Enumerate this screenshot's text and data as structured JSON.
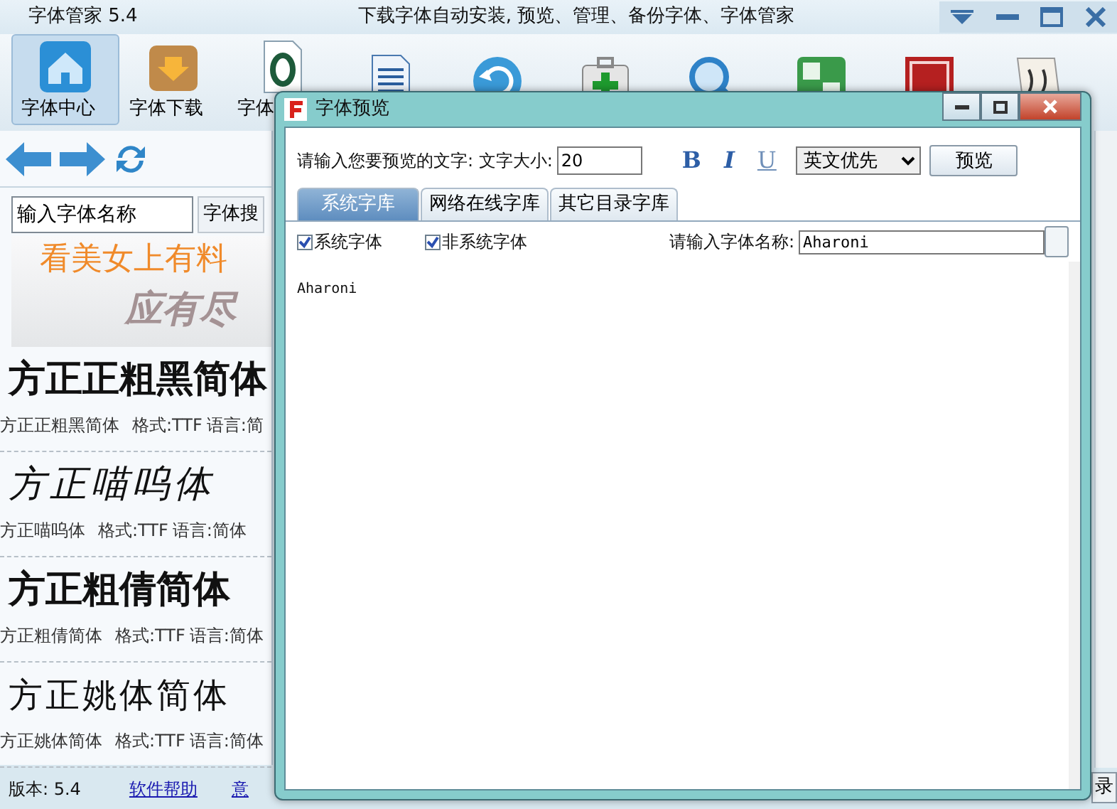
{
  "window": {
    "title": "字体管家 5.4",
    "subtitle": "下载字体自动安装, 预览、管理、备份字体、字体管家"
  },
  "toolbar": [
    {
      "kind": "home",
      "label": "字体中心",
      "selected": true
    },
    {
      "kind": "download",
      "label": "字体下载",
      "selected": false
    },
    {
      "kind": "fontfile",
      "label": "字体",
      "selected": false
    },
    {
      "kind": "document",
      "selected": false
    },
    {
      "kind": "undo",
      "selected": false
    },
    {
      "kind": "kit",
      "selected": false
    },
    {
      "kind": "magnifier",
      "selected": false
    },
    {
      "kind": "greentile",
      "selected": false
    },
    {
      "kind": "redseal",
      "selected": false
    },
    {
      "kind": "paper",
      "selected": false
    }
  ],
  "search": {
    "value": "输入字体名称",
    "button": "字体搜"
  },
  "banner": {
    "line_1": "看美女上有料",
    "line_2": "应有尽"
  },
  "fonts": [
    {
      "sample": "方正正粗黑简体",
      "kind": "heavy",
      "name": "方正正粗黑简体",
      "format": "格式:TTF",
      "language": "语言:简"
    },
    {
      "sample": "方正喵呜体",
      "kind": "hand",
      "name": "方正喵呜体",
      "format": "格式:TTF",
      "language": "语言:简体"
    },
    {
      "sample": "方正粗倩简体",
      "kind": "heavy",
      "name": "方正粗倩简体",
      "format": "格式:TTF",
      "language": "语言:简体"
    },
    {
      "sample": "方正姚体简体",
      "kind": "thin",
      "name": "方正姚体简体",
      "format": "格式:TTF",
      "language": "语言:简体"
    }
  ],
  "status_bar": {
    "version": "版本: 5.4",
    "help_link": "软件帮助",
    "link_3": "意"
  },
  "corner_button": "录",
  "dialog": {
    "title": "字体预览",
    "text_label": "请输入您要预览的文字: 文字大小:",
    "size": "20",
    "format_buttons": [
      {
        "text": "B",
        "kind": "bold"
      },
      {
        "text": "I",
        "kind": "italic"
      },
      {
        "text": "U",
        "kind": "underline"
      }
    ],
    "language_select": "英文优先",
    "preview_button": "预览",
    "tabs": [
      {
        "label": "系统字库",
        "selected": true
      },
      {
        "label": "网络在线字库",
        "selected": false
      },
      {
        "label": "其它目录字库",
        "selected": false
      }
    ],
    "filters": [
      {
        "label": "系统字体",
        "checked": true
      },
      {
        "label": "非系统字体",
        "checked": true
      }
    ],
    "name_label": "请输入字体名称:",
    "name_value": "Aharoni",
    "results": [
      "Aharoni"
    ]
  }
}
